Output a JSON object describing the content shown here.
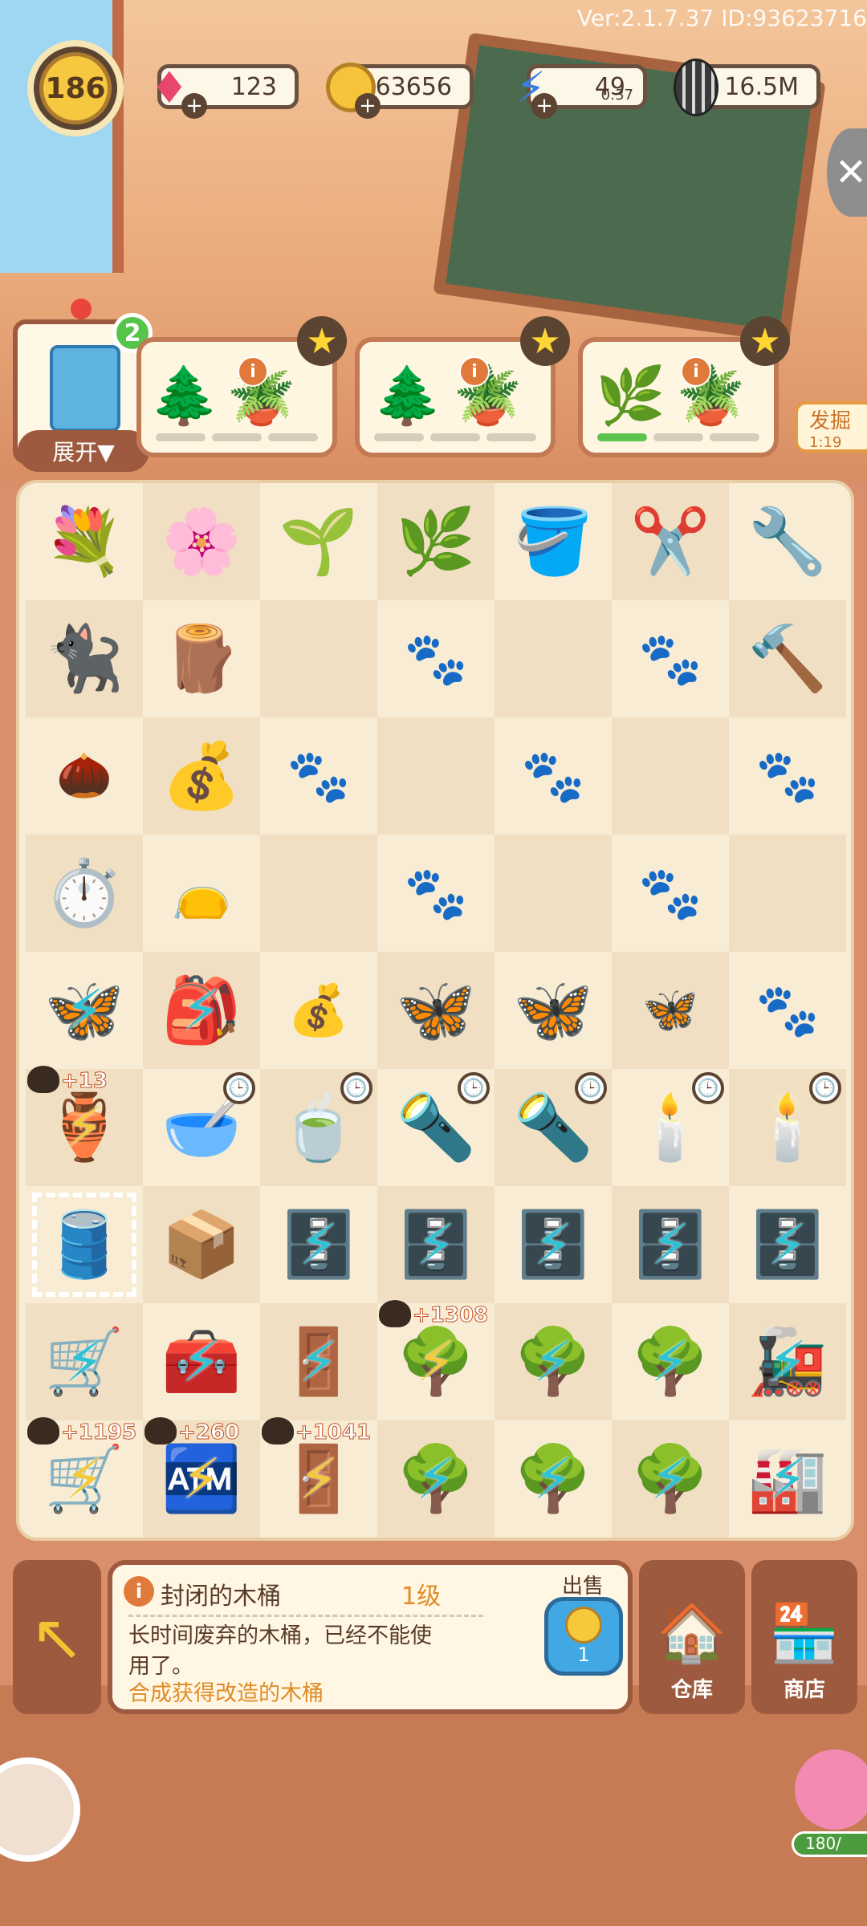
{
  "version": "Ver:2.1.7.37 ID:93623716",
  "player": {
    "level": "186"
  },
  "resources": {
    "gems": {
      "icon": "gem-icon",
      "value": "123"
    },
    "coins": {
      "icon": "coin-icon",
      "value": "63656"
    },
    "energy": {
      "icon": "lightning-icon",
      "value": "49",
      "timer": "0:37"
    },
    "seeds": {
      "icon": "sunflower-seed-icon",
      "value": "16.5M"
    }
  },
  "expand": {
    "badge": "2",
    "label": "展开▼"
  },
  "dig": {
    "label": "发掘",
    "timer": "1:19"
  },
  "quests": [
    {
      "items": [
        "🌲",
        "🪴"
      ],
      "bars": [
        false,
        false,
        false
      ]
    },
    {
      "items": [
        "🌲",
        "🪴"
      ],
      "bars": [
        false,
        false,
        false
      ]
    },
    {
      "items": [
        "🌿",
        "🪴"
      ],
      "bars": [
        true,
        false,
        false
      ]
    }
  ],
  "board": {
    "bonuses": [
      "+13",
      "+1308",
      "+1195",
      "+260",
      "+1041"
    ]
  },
  "selected_item": {
    "name": "封闭的木桶",
    "level": "1级",
    "description": "长时间废弃的木桶，已经不能使用了。",
    "hint": "合成获得改造的木桶",
    "sell_label": "出售",
    "sell_price": "1"
  },
  "buttons": {
    "warehouse": "仓库",
    "shop": "商店"
  },
  "pig_progress": "180/"
}
